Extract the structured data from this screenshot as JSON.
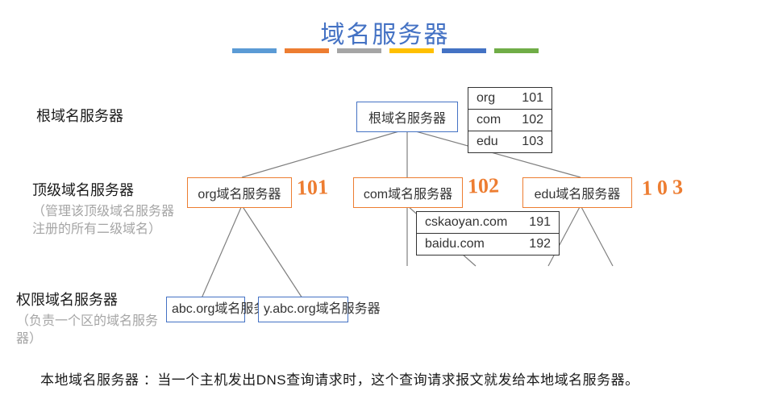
{
  "title": "域名服务器",
  "bars": [
    "blue",
    "orange",
    "gray",
    "yellow",
    "navy",
    "green"
  ],
  "levels": {
    "root": {
      "label": "根域名服务器",
      "sub": ""
    },
    "tld": {
      "label": "顶级域名服务器",
      "sub": "（管理该顶级域名服务器注册的所有二级域名）"
    },
    "auth": {
      "label": "权限域名服务器",
      "sub": "（负责一个区的域名服务器）"
    }
  },
  "nodes": {
    "root": "根域名服务器",
    "tld_org": "org域名服务器",
    "tld_com": "com域名服务器",
    "tld_edu": "edu域名服务器",
    "auth_abc": "abc.org域名服务器",
    "auth_yabc": "y.abc.org域名服务器"
  },
  "root_table": [
    {
      "name": "org",
      "addr": "101"
    },
    {
      "name": "com",
      "addr": "102"
    },
    {
      "name": "edu",
      "addr": "103"
    }
  ],
  "com_table": [
    {
      "name": "cskaoyan.com",
      "addr": "191"
    },
    {
      "name": "baidu.com",
      "addr": "192"
    }
  ],
  "handnotes": {
    "n101": "101",
    "n102": "102",
    "n103": "103"
  },
  "footer": "本地域名服务器 ：当一个主机发出DNS查询请求时，这个查询请求报文就发给本地域名服务器。"
}
